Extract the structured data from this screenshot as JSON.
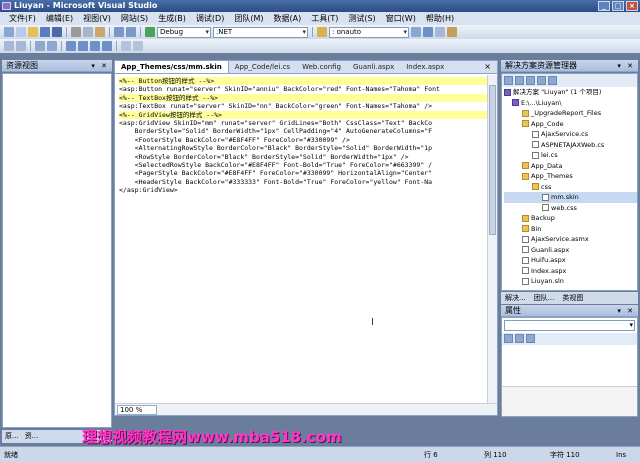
{
  "titlebar": {
    "title": "Liuyan - Microsoft Visual Studio",
    "min": "_",
    "max": "□",
    "close": "×"
  },
  "menu": [
    "文件(F)",
    "编辑(E)",
    "视图(V)",
    "网站(S)",
    "生成(B)",
    "调试(D)",
    "团队(M)",
    "数据(A)",
    "工具(T)",
    "测试(S)",
    "窗口(W)",
    "帮助(H)"
  ],
  "toolbar": {
    "config": "Debug",
    "platform": ".NET",
    "find": ": onauto"
  },
  "left_panel": {
    "title": "资源视图",
    "pin": "▾ ✕"
  },
  "editor": {
    "tabs": [
      "App_Themes/css/mm.skin",
      "App_Code/lei.cs",
      "Web.config",
      "Guanli.aspx",
      "Index.aspx"
    ],
    "close": "×",
    "lines": [
      "<%-- Button按钮的样式 --%>",
      "<asp:Button runat=\"server\" SkinID=\"anniu\" BackColor=\"red\" Font-Names=\"Tahoma\" Font",
      "<%-- TextBox按钮的样式 --%>",
      "<asp:TextBox runat=\"server\" SkinID=\"nn\" BackColor=\"green\" Font-Names=\"Tahoma\" />",
      "<%-- GridView按钮的样式 --%>",
      "<asp:GridView SkinID=\"mm\" runat=\"server\" GridLines=\"Both\" CssClass=\"Text\" BackCo",
      "    BorderStyle=\"Solid\" BorderWidth=\"1px\" CellPadding=\"4\" AutoGenerateColumns=\"F",
      "    <FooterStyle BackColor=\"#E8F4FF\" ForeColor=\"#330099\" />",
      "    <AlternatingRowStyle BorderColor=\"Black\" BorderStyle=\"Solid\" BorderWidth=\"1p",
      "    <RowStyle BorderColor=\"Black\" BorderStyle=\"Solid\" BorderWidth=\"1px\" />",
      "    <SelectedRowStyle BackColor=\"#E8F4FF\" Font-Bold=\"True\" ForeColor=\"#663399\" /",
      "    <PagerStyle BackColor=\"#E8F4FF\" ForeColor=\"#330099\" HorizontalAlign=\"Center\"",
      "    <HeaderStyle BackColor=\"#333333\" Font-Bold=\"True\" ForeColor=\"yellow\" Font-Na",
      "</asp:GridView>"
    ],
    "zoom": "100 %",
    "caret": "I"
  },
  "solution": {
    "title": "解决方案资源管理器",
    "pin": "▾ ✕",
    "items": [
      "解决方案 \"Liuyan\" (1 个项目)",
      "E:\\...\\Liuyan\\",
      "_UpgradeReport_Files",
      "App_Code",
      "AjaxService.cs",
      "ASPNETAJAXWeb.cs",
      "lei.cs",
      "App_Data",
      "App_Themes",
      "css",
      "mm.skin",
      "web.css",
      "Backup",
      "Bin",
      "AjaxService.asmx",
      "Guanli.aspx",
      "Huifu.aspx",
      "Index.aspx",
      "Liuyan.sln"
    ]
  },
  "right_tabs": [
    "解决...",
    "团队...",
    "类视图"
  ],
  "properties": {
    "title": "属性",
    "pin": "▾ ✕"
  },
  "bottom_tabs": [
    "原...",
    "资..."
  ],
  "watermark": "理想视频教程网www.mba518.com",
  "status": {
    "ready": "就绪",
    "row": "行 6",
    "col": "列 110",
    "char": "字符 110",
    "mode": "Ins"
  },
  "colors": {
    "accent": "#2b4c86",
    "highlight": "#ffff9a",
    "watermark": "#ff36c8"
  }
}
